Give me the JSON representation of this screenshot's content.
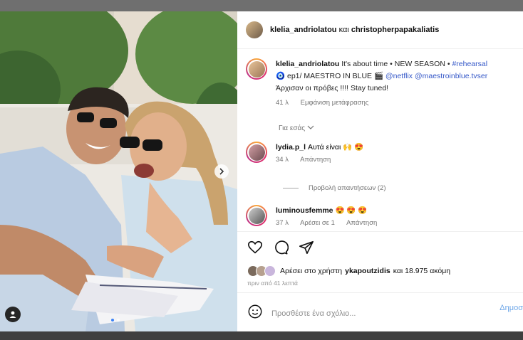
{
  "header": {
    "user1": "klelia_andriolatou",
    "and": "και",
    "user2": "christopherpapakaliatis"
  },
  "caption": {
    "user": "klelia_andriolatou",
    "line1_text": "It's about time • NEW SEASON •",
    "line1_tag": "#rehearsal",
    "line2_pre": "🧿 ep1/ MAESTRO IN BLUE 🎬",
    "line2_tags": "@netflix @maestroinblue.tvser",
    "line3": "Άρχισαν οι πρόβες !!!! Stay tuned!",
    "time": "41 λ",
    "translate": "Εμφάνιση μετάφρασης"
  },
  "for_you": "Για εσάς",
  "comments": [
    {
      "user": "lydia.p_l",
      "text": "Αυτά είναι 🙌 😍",
      "time": "34 λ",
      "reply": "Απάντηση"
    },
    {
      "user": "luminousfemme",
      "text": "😍 😍 😍",
      "time": "37 λ",
      "likes": "Αρέσει σε 1",
      "reply": "Απάντηση"
    }
  ],
  "view_replies": "Προβολή απαντήσεων (2)",
  "likes": {
    "prefix": "Αρέσει στο χρήστη",
    "user": "ykapoutzidis",
    "rest": "και 18.975 ακόμη"
  },
  "time_ago": "πριν από 41 λεπτά",
  "add_comment": {
    "placeholder": "Προσθέστε ένα σχόλιο...",
    "post_label": "Δημοσ"
  },
  "icons": [
    "heart-icon",
    "comment-icon",
    "share-icon",
    "emoji-icon",
    "user-tag-icon",
    "next-arrow-icon"
  ],
  "colors": {
    "link": "#3558c8",
    "post": "#6ea7e8",
    "meta": "#737373"
  }
}
